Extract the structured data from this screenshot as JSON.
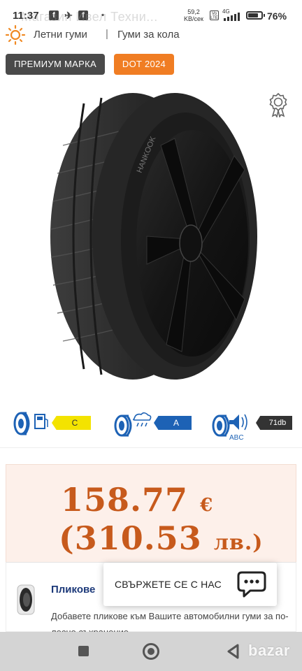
{
  "status_bar": {
    "time": "11:37",
    "network_speed": "59,2",
    "network_unit": "KB/сек",
    "network_type": "4G",
    "battery": "76%",
    "battery_level": 0.76,
    "page_title_overlay": "Магазин Ивел Техни..."
  },
  "breadcrumb": {
    "items": [
      {
        "label": "Летни гуми"
      },
      {
        "label": "Гуми за кола"
      }
    ],
    "separator": "|"
  },
  "badges": {
    "premium": "ПРЕМИУМ МАРКА",
    "dot": "DOT 2024"
  },
  "eu_label": {
    "fuel_class": "C",
    "wet_grip_class": "A",
    "noise": "71db",
    "fuel_color": "#f3e300",
    "wet_color": "#1d62b5"
  },
  "price": {
    "eur_value": "158.77",
    "eur_currency": "€",
    "bgn_value": "(310.53",
    "bgn_currency": "лв.)",
    "color": "#c75a1c"
  },
  "addon": {
    "title": "Пликове",
    "description": "Добавете пликове към Вашите автомобилни гуми за по-лесно съхранение."
  },
  "contact": {
    "label": "СВЪРЖЕТЕ СЕ С НАС"
  },
  "watermark": "bazar"
}
